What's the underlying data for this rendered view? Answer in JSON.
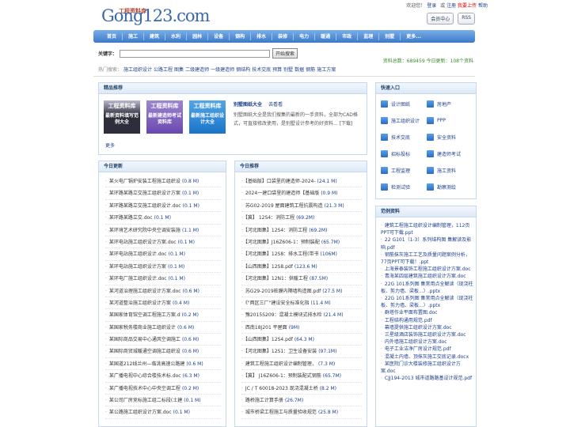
{
  "header": {
    "logo_text": "Gong123.com",
    "logo_subtitle": "工程资料库",
    "welcome": "欢迎您！",
    "login": "登录",
    "or": "或",
    "register": "注册",
    "upload": "我要上传",
    "help": "帮助",
    "member_center": "会员中心",
    "rss": "RSS"
  },
  "nav": [
    "首页",
    "施工",
    "建筑",
    "水利",
    "园林",
    "设备",
    "钢构",
    "排水",
    "装修",
    "电力",
    "暖通",
    "市政",
    "监理",
    "别墅",
    "更多..."
  ],
  "search": {
    "label": "关键字：",
    "value": "",
    "button": "开始搜索",
    "stats": "资料总数：689459 今日更新：108个资料",
    "hot_label": "热门搜索：",
    "hot": [
      "施工组织设计",
      "公路工程",
      "图集",
      "二级建造师",
      "一级建造师",
      "钢结构",
      "技术交底",
      "预算",
      "别墅",
      "数据",
      "钢筋",
      "施工方案"
    ]
  },
  "featured": {
    "title": "精品推荐",
    "books": [
      {
        "top": "工程资料库",
        "bottom": "最新资料填写范例大全"
      },
      {
        "top": "工程资料库",
        "bottom": "最新建造师考试资料库"
      },
      {
        "top": "工程资料库",
        "bottom": "最新施工组织设计大全"
      }
    ],
    "headline": "别墅图纸大全",
    "headline_link": "去看看",
    "desc": "别墅图纸大全是我们搜集的最新的一手资料，全部为CAD格式，可直接修改使用，是别墅设计参考的好资料... [下载]",
    "more": "更多"
  },
  "today_update": {
    "title": "今日更新",
    "items": [
      {
        "name": "某火电厂锅炉安装工程施工组织设",
        "size": "(0.8 M)"
      },
      {
        "name": "某环路某路立交施工组织设计方案",
        "size": "(0.1 M)"
      },
      {
        "name": "某环路某路立交施工组织设计.doc",
        "size": "(0.1 M)"
      },
      {
        "name": "某环路某路立交.doc",
        "size": "(0.1 M)"
      },
      {
        "name": "某环境艺术研究院中央空调安装施",
        "size": "(1.1 M)"
      },
      {
        "name": "某环电站施工组织设计方案.doc",
        "size": "(0.1 M)"
      },
      {
        "name": "某环电站施工组织设计.doc",
        "size": "(0.1 M)"
      },
      {
        "name": "某环电站施工组织设计方案",
        "size": "(0.1 M)"
      },
      {
        "name": "某环电厂施工组织设计.doc",
        "size": "(0.1 M)"
      },
      {
        "name": "某河道治理施工组织设计方案.doc",
        "size": "(0.6 M)"
      },
      {
        "name": "某河道整治施工组织设计方案",
        "size": "(0.4 M)"
      },
      {
        "name": "某国家体育馆空调工程施工方案.d",
        "size": "(0.2 M)"
      },
      {
        "name": "某国家税务楼商业施工组织设计",
        "size": "(0.6 M)"
      },
      {
        "name": "某国际商品交易中心通风空调施工",
        "size": "(0.6 M)"
      },
      {
        "name": "某国际商贸城暖通空调施工组织设",
        "size": "(0.6 M)"
      },
      {
        "name": "某国道212线兰州—临洮高速公路建",
        "size": "(0.6 M)"
      },
      {
        "name": "某广播电视中心综合楼技术标.doc",
        "size": "(6.3 M)"
      },
      {
        "name": "某广播电视技术中心中央空调工程",
        "size": "(0.2 M)"
      },
      {
        "name": "某公司厂房竞标施工组二标段(土建",
        "size": "(0.1 M)"
      },
      {
        "name": "某公路施工组织设计方案.doc",
        "size": "(0.1 M)"
      }
    ]
  },
  "today_rec": {
    "title": "今日推荐",
    "items": [
      {
        "name": "【基础版】口袋里的建造师-2024-",
        "size": "(24.1 M)"
      },
      {
        "name": "2024一建口袋里的建造师【基础版",
        "size": "(0.9 M)"
      },
      {
        "name": "苏G02-2019 屋面建筑工程抗震构造",
        "size": "(21.3 M)"
      },
      {
        "name": "【冀】 12S4：消防工程",
        "size": "(69.2M)"
      },
      {
        "name": "【河北图集】12S4：消防工程",
        "size": "(69.2M)"
      },
      {
        "name": "【河北图集】J16Z606-1：预制装配",
        "size": "(65.7M)"
      },
      {
        "name": "【河北图集】12S8：排水工程(带书",
        "size": "(106M)"
      },
      {
        "name": "【山西图集】12S8.pdf",
        "size": "(123.6 M)"
      },
      {
        "name": "【河北图集】12N1：供暖工程",
        "size": "(87.5M)"
      },
      {
        "name": "苏G29-2019桩膜内隔墙构造图.pdf",
        "size": "(27.5 M)"
      },
      {
        "name": "《\"两区三厂\"建设安全标准化指",
        "size": "(11.4 M)"
      },
      {
        "name": "豫2015S209：混凝土模块式排水检",
        "size": "(21.4 M)"
      },
      {
        "name": "西南18J201 平屋面",
        "size": "(9M)"
      },
      {
        "name": "【山西图集】12S4.pdf",
        "size": "(64.3 M)"
      },
      {
        "name": "【河北图集】12S1：卫生设备安装",
        "size": "(97.1M)"
      },
      {
        "name": "建筑工程施工组织设计编制管理，",
        "size": "(7.3 M)"
      },
      {
        "name": "【冀】 J16Z606-1：预制装配式钢筋",
        "size": "(65.7M)"
      },
      {
        "name": "JC / T 60018-2023 现浇混凝土桥",
        "size": "(8.2 M)"
      },
      {
        "name": "路桥施工计算手册",
        "size": "(26.7M)"
      },
      {
        "name": "城市桥梁工程施工与质量验收规范",
        "size": "(25.8 M)"
      }
    ]
  },
  "quick": {
    "title": "快速入口",
    "items": [
      "设计图纸",
      "房地产",
      "施工组织设计",
      "PPP",
      "技术交底",
      "安全资料",
      "招标投标",
      "建造师考试",
      "工程监理",
      "施工资料",
      "检测试验",
      "勘察测绘"
    ]
  },
  "cases": {
    "title": "范例资料",
    "items": [
      "建筑工程施工组织设计编制管理，112页PPT可下载.ppt",
      "22 G101（1-3）系列结构图 集解读及影响.pdf",
      "钢筋抹灰施工工艺及质量问题案例分析，77页PPT可下载！.ppt",
      "上海景泰装饰工程施工组织设计方案.doc",
      "青海某四层建筑施工组织设计方案.doc",
      "22G 101系列图 集常用点全解读（现浇柱板、剪力墙、梁板...）.pptx",
      "22G 101系列图 集常用点全解读（现浇柱板、剪力墙、梁板...）.pptx",
      "群塔作业平面布置图.doc",
      "工程结构通用规范.pdf",
      "幕墙提供施工组织设计方案.doc",
      "三星级酒店装饰施工组织设计方案.doc",
      "内外墙施工组织设计方案.doc",
      "电子工业洁净厂房设计规范.pdf",
      "混凝土内墙、顶抹灰施工交底记录.docx",
      "某医院门诊大楼装修施工组织设计方案.doc",
      "CJJ194-2013 城市道路路基设计规范.pdf"
    ]
  }
}
